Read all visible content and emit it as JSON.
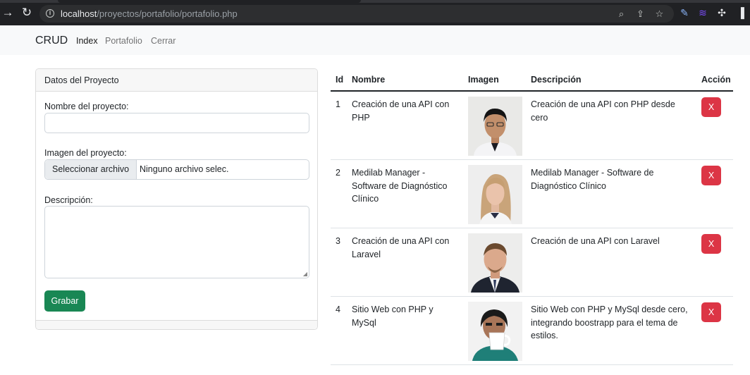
{
  "browser": {
    "url_host": "localhost",
    "url_path": "/proyectos/portafolio/portafolio.php"
  },
  "navbar": {
    "brand": "CRUD",
    "links": [
      "Index",
      "Portafolio",
      "Cerrar"
    ]
  },
  "form": {
    "header": "Datos del Proyecto",
    "name_label": "Nombre del proyecto:",
    "name_value": "",
    "image_label": "Imagen del proyecto:",
    "file_button": "Seleccionar archivo",
    "file_status": "Ninguno archivo selec.",
    "description_label": "Descripción:",
    "description_value": "",
    "save_label": "Grabar"
  },
  "table": {
    "headers": [
      "Id",
      "Nombre",
      "Imagen",
      "Descripción",
      "Acción"
    ],
    "rows": [
      {
        "id": "1",
        "nombre": "Creación de una API con PHP",
        "descripcion": "Creación de una API con PHP desde cero",
        "accion": "X"
      },
      {
        "id": "2",
        "nombre": "Medilab Manager - Software de Diagnóstico Clínico",
        "descripcion": "Medilab Manager - Software de Diagnóstico Clínico",
        "accion": "X"
      },
      {
        "id": "3",
        "nombre": "Creación de una API con Laravel",
        "descripcion": "Creación de una API con Laravel",
        "accion": "X"
      },
      {
        "id": "4",
        "nombre": "Sitio Web con PHP y MySql",
        "descripcion": "Sitio Web con PHP y MySql desde cero, integrando boostrapp para el tema de estilos.",
        "accion": "X"
      }
    ]
  },
  "colors": {
    "save": "#198754",
    "delete": "#dc3545",
    "navbar_bg": "#f8f9fa"
  }
}
